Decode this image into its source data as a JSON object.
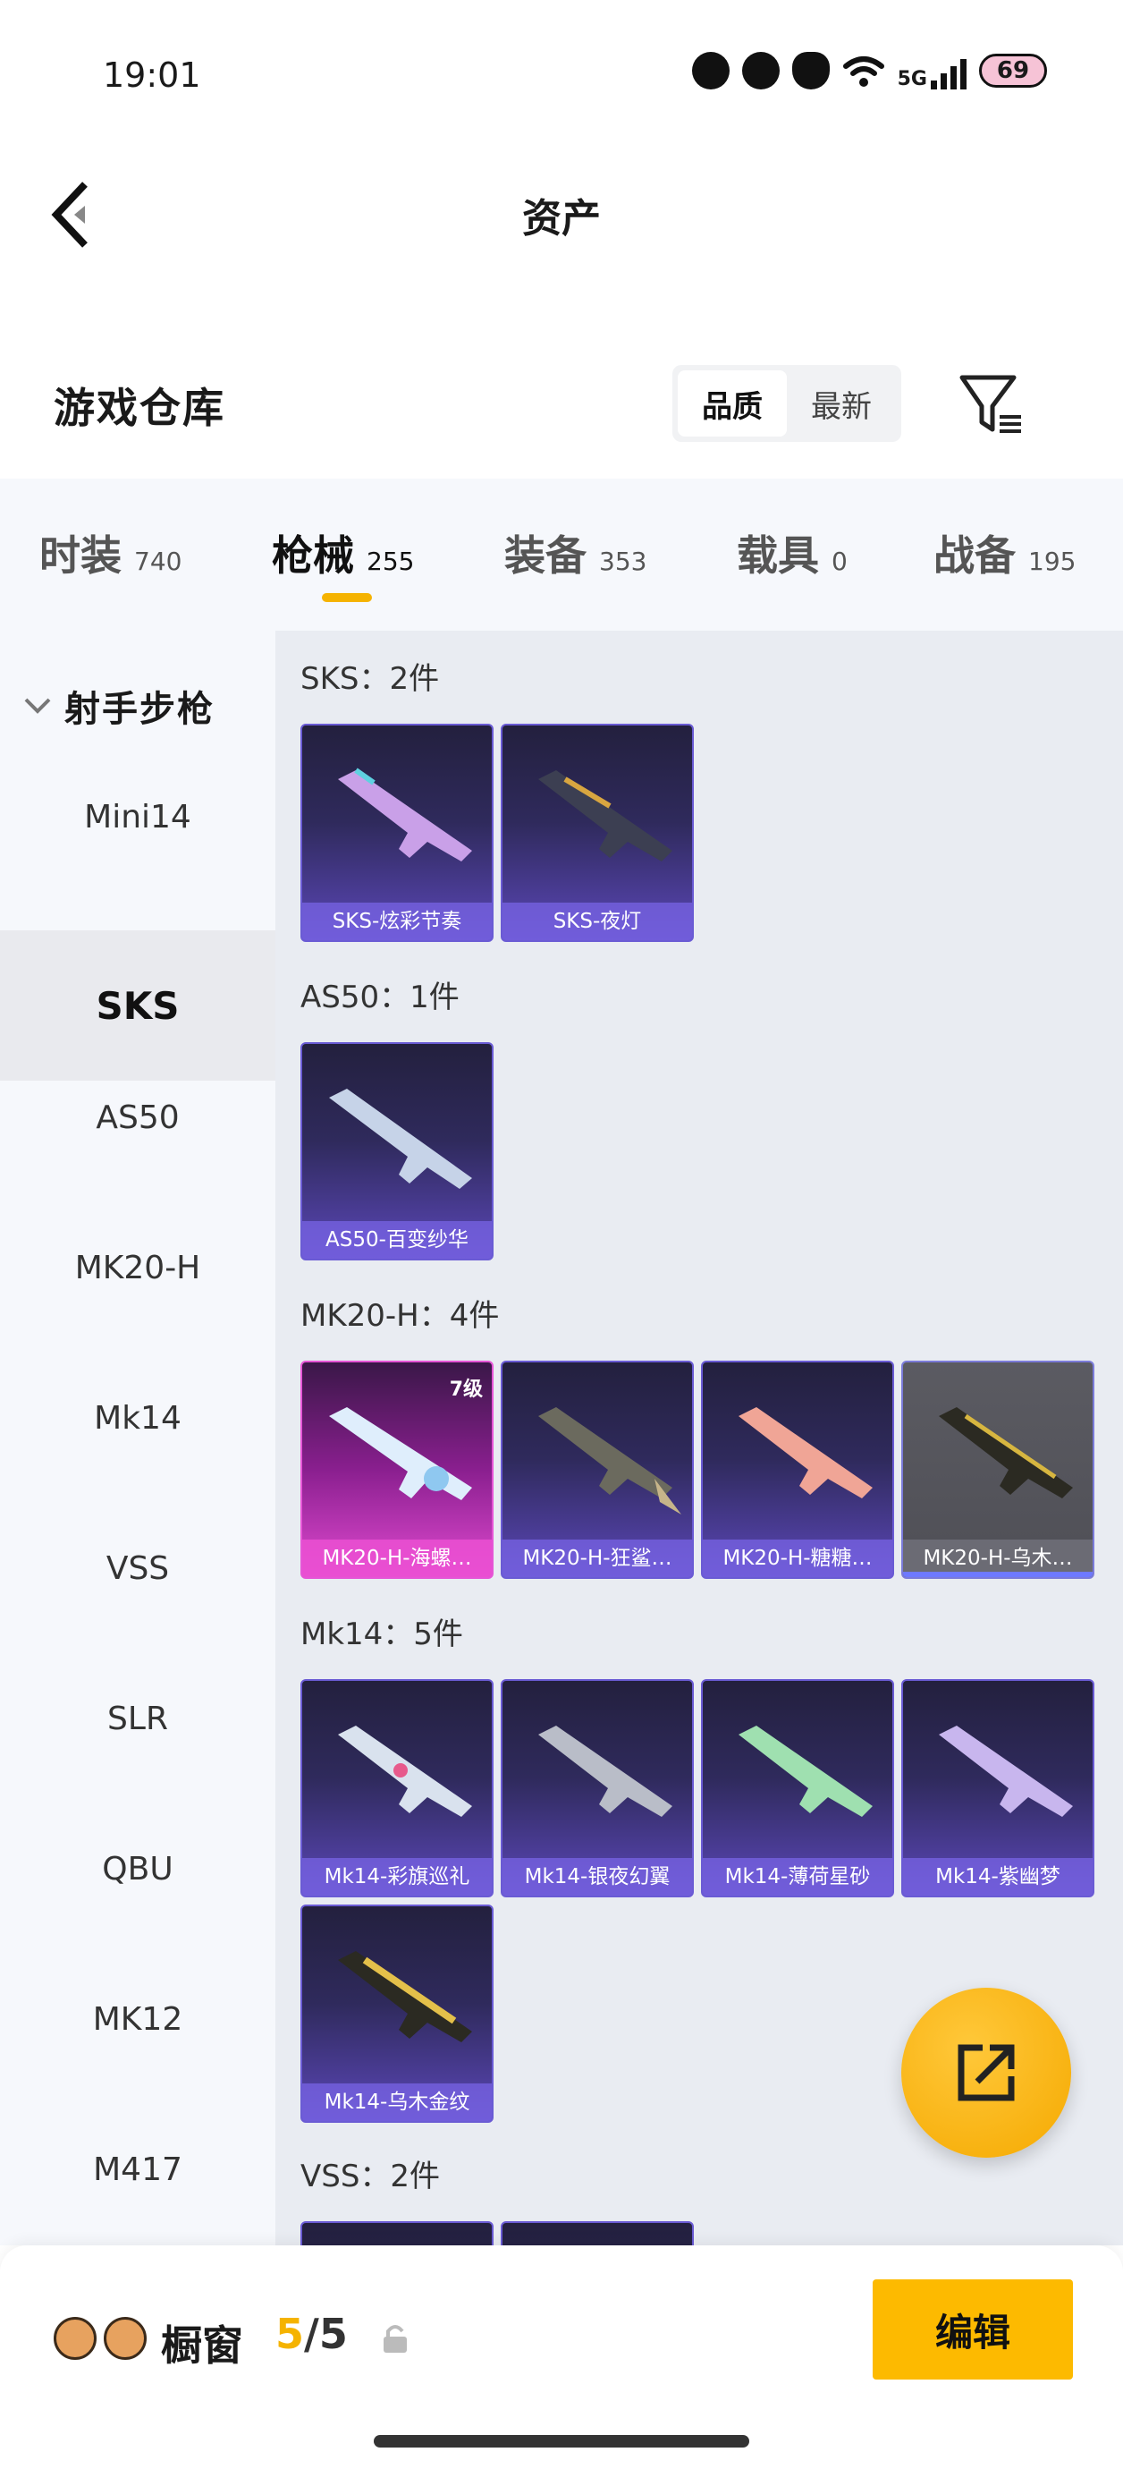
{
  "status_bar": {
    "time": "19:01",
    "network": "5G",
    "battery": "69"
  },
  "header": {
    "title": "资产"
  },
  "warehouse": {
    "title": "游戏仓库",
    "sort_options": [
      "品质",
      "最新"
    ],
    "sort_selected": "品质"
  },
  "category_tabs": [
    {
      "label": "时装",
      "count": "740"
    },
    {
      "label": "枪械",
      "count": "255",
      "active": true
    },
    {
      "label": "装备",
      "count": "353"
    },
    {
      "label": "载具",
      "count": "0"
    },
    {
      "label": "战备",
      "count": "195"
    }
  ],
  "side_nav": {
    "group_label": "射手步枪",
    "items": [
      "Mini14",
      "SKS",
      "AS50",
      "MK20-H",
      "Mk14",
      "VSS",
      "SLR",
      "QBU",
      "MK12",
      "M417"
    ],
    "active": "SKS"
  },
  "groups": [
    {
      "title": "SKS：2件",
      "items": [
        {
          "name": "SKS-炫彩节奏"
        },
        {
          "name": "SKS-夜灯"
        }
      ]
    },
    {
      "title": "AS50：1件",
      "items": [
        {
          "name": "AS50-百变纱华"
        }
      ]
    },
    {
      "title": "MK20-H：4件",
      "items": [
        {
          "name": "MK20-H-海螺…",
          "level": "7级"
        },
        {
          "name": "MK20-H-狂鲨…"
        },
        {
          "name": "MK20-H-糖糖…"
        },
        {
          "name": "MK20-H-乌木…"
        }
      ]
    },
    {
      "title": "Mk14：5件",
      "items": [
        {
          "name": "Mk14-彩旗巡礼"
        },
        {
          "name": "Mk14-银夜幻翼"
        },
        {
          "name": "Mk14-薄荷星砂"
        },
        {
          "name": "Mk14-紫幽梦"
        },
        {
          "name": "Mk14-乌木金纹"
        }
      ]
    },
    {
      "title": "VSS：2件",
      "items": []
    }
  ],
  "bottom_bar": {
    "label": "橱窗",
    "current": "5",
    "total": "/5",
    "edit_label": "编辑"
  },
  "colors": {
    "accent": "#f5b300",
    "card_purple": "#5b47b8",
    "card_pink": "#e04ad0"
  }
}
